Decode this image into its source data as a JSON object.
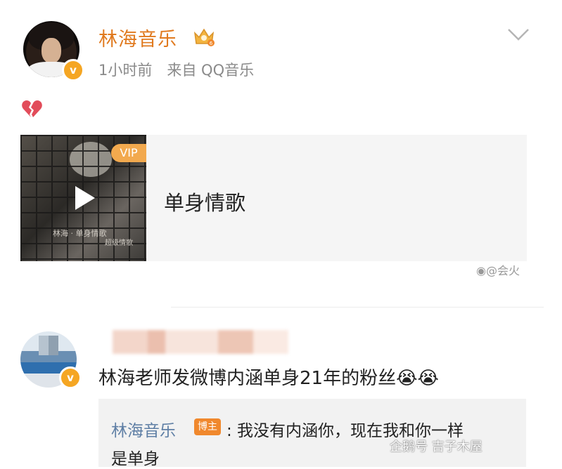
{
  "post": {
    "author_name": "林海音乐",
    "verified_badge": "v",
    "meta": "1小时前　来自 QQ音乐",
    "content_emoji": "broken-heart-icon",
    "music_card": {
      "vip_label": "VIP",
      "cover_caption": "林海 · 单身情歌",
      "cover_caption_small": "超级情歌",
      "song_title": "单身情歌"
    }
  },
  "watermark_weibo": "@会火",
  "comment": {
    "verified_badge": "v",
    "text": "林海老师发微博内涵单身21年的粉丝😭😭",
    "reply": {
      "author": "林海音乐",
      "role_badge": "博主",
      "text_line1": ": 我没有内涵你，现在我和你一样",
      "text_line2": "是单身"
    }
  },
  "watermark_penguin": "企鹅号 吉子木屋",
  "colors": {
    "author_orange": "#e07a1f",
    "reply_blue": "#5f7fa5",
    "badge_orange": "#f0882d",
    "vip_orange": "#f2a94e"
  }
}
